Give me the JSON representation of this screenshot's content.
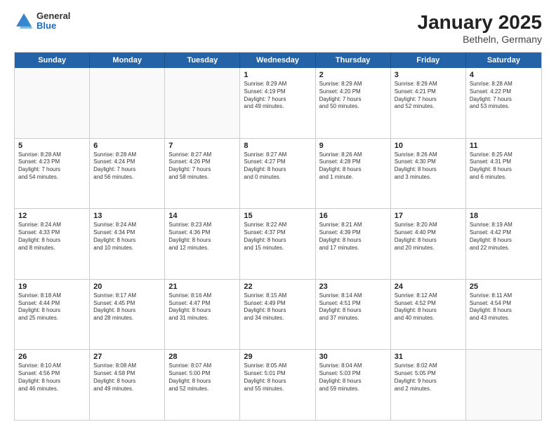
{
  "header": {
    "logo_general": "General",
    "logo_blue": "Blue",
    "main_title": "January 2025",
    "sub_title": "Betheln, Germany"
  },
  "weekdays": [
    "Sunday",
    "Monday",
    "Tuesday",
    "Wednesday",
    "Thursday",
    "Friday",
    "Saturday"
  ],
  "rows": [
    [
      {
        "day": "",
        "detail": ""
      },
      {
        "day": "",
        "detail": ""
      },
      {
        "day": "",
        "detail": ""
      },
      {
        "day": "1",
        "detail": "Sunrise: 8:29 AM\nSunset: 4:19 PM\nDaylight: 7 hours\nand 49 minutes."
      },
      {
        "day": "2",
        "detail": "Sunrise: 8:29 AM\nSunset: 4:20 PM\nDaylight: 7 hours\nand 50 minutes."
      },
      {
        "day": "3",
        "detail": "Sunrise: 8:29 AM\nSunset: 4:21 PM\nDaylight: 7 hours\nand 52 minutes."
      },
      {
        "day": "4",
        "detail": "Sunrise: 8:28 AM\nSunset: 4:22 PM\nDaylight: 7 hours\nand 53 minutes."
      }
    ],
    [
      {
        "day": "5",
        "detail": "Sunrise: 8:28 AM\nSunset: 4:23 PM\nDaylight: 7 hours\nand 54 minutes."
      },
      {
        "day": "6",
        "detail": "Sunrise: 8:28 AM\nSunset: 4:24 PM\nDaylight: 7 hours\nand 56 minutes."
      },
      {
        "day": "7",
        "detail": "Sunrise: 8:27 AM\nSunset: 4:26 PM\nDaylight: 7 hours\nand 58 minutes."
      },
      {
        "day": "8",
        "detail": "Sunrise: 8:27 AM\nSunset: 4:27 PM\nDaylight: 8 hours\nand 0 minutes."
      },
      {
        "day": "9",
        "detail": "Sunrise: 8:26 AM\nSunset: 4:28 PM\nDaylight: 8 hours\nand 1 minute."
      },
      {
        "day": "10",
        "detail": "Sunrise: 8:26 AM\nSunset: 4:30 PM\nDaylight: 8 hours\nand 3 minutes."
      },
      {
        "day": "11",
        "detail": "Sunrise: 8:25 AM\nSunset: 4:31 PM\nDaylight: 8 hours\nand 6 minutes."
      }
    ],
    [
      {
        "day": "12",
        "detail": "Sunrise: 8:24 AM\nSunset: 4:33 PM\nDaylight: 8 hours\nand 8 minutes."
      },
      {
        "day": "13",
        "detail": "Sunrise: 8:24 AM\nSunset: 4:34 PM\nDaylight: 8 hours\nand 10 minutes."
      },
      {
        "day": "14",
        "detail": "Sunrise: 8:23 AM\nSunset: 4:36 PM\nDaylight: 8 hours\nand 12 minutes."
      },
      {
        "day": "15",
        "detail": "Sunrise: 8:22 AM\nSunset: 4:37 PM\nDaylight: 8 hours\nand 15 minutes."
      },
      {
        "day": "16",
        "detail": "Sunrise: 8:21 AM\nSunset: 4:39 PM\nDaylight: 8 hours\nand 17 minutes."
      },
      {
        "day": "17",
        "detail": "Sunrise: 8:20 AM\nSunset: 4:40 PM\nDaylight: 8 hours\nand 20 minutes."
      },
      {
        "day": "18",
        "detail": "Sunrise: 8:19 AM\nSunset: 4:42 PM\nDaylight: 8 hours\nand 22 minutes."
      }
    ],
    [
      {
        "day": "19",
        "detail": "Sunrise: 8:18 AM\nSunset: 4:44 PM\nDaylight: 8 hours\nand 25 minutes."
      },
      {
        "day": "20",
        "detail": "Sunrise: 8:17 AM\nSunset: 4:45 PM\nDaylight: 8 hours\nand 28 minutes."
      },
      {
        "day": "21",
        "detail": "Sunrise: 8:16 AM\nSunset: 4:47 PM\nDaylight: 8 hours\nand 31 minutes."
      },
      {
        "day": "22",
        "detail": "Sunrise: 8:15 AM\nSunset: 4:49 PM\nDaylight: 8 hours\nand 34 minutes."
      },
      {
        "day": "23",
        "detail": "Sunrise: 8:14 AM\nSunset: 4:51 PM\nDaylight: 8 hours\nand 37 minutes."
      },
      {
        "day": "24",
        "detail": "Sunrise: 8:12 AM\nSunset: 4:52 PM\nDaylight: 8 hours\nand 40 minutes."
      },
      {
        "day": "25",
        "detail": "Sunrise: 8:11 AM\nSunset: 4:54 PM\nDaylight: 8 hours\nand 43 minutes."
      }
    ],
    [
      {
        "day": "26",
        "detail": "Sunrise: 8:10 AM\nSunset: 4:56 PM\nDaylight: 8 hours\nand 46 minutes."
      },
      {
        "day": "27",
        "detail": "Sunrise: 8:08 AM\nSunset: 4:58 PM\nDaylight: 8 hours\nand 49 minutes."
      },
      {
        "day": "28",
        "detail": "Sunrise: 8:07 AM\nSunset: 5:00 PM\nDaylight: 8 hours\nand 52 minutes."
      },
      {
        "day": "29",
        "detail": "Sunrise: 8:05 AM\nSunset: 5:01 PM\nDaylight: 8 hours\nand 55 minutes."
      },
      {
        "day": "30",
        "detail": "Sunrise: 8:04 AM\nSunset: 5:03 PM\nDaylight: 8 hours\nand 59 minutes."
      },
      {
        "day": "31",
        "detail": "Sunrise: 8:02 AM\nSunset: 5:05 PM\nDaylight: 9 hours\nand 2 minutes."
      },
      {
        "day": "",
        "detail": ""
      }
    ]
  ]
}
